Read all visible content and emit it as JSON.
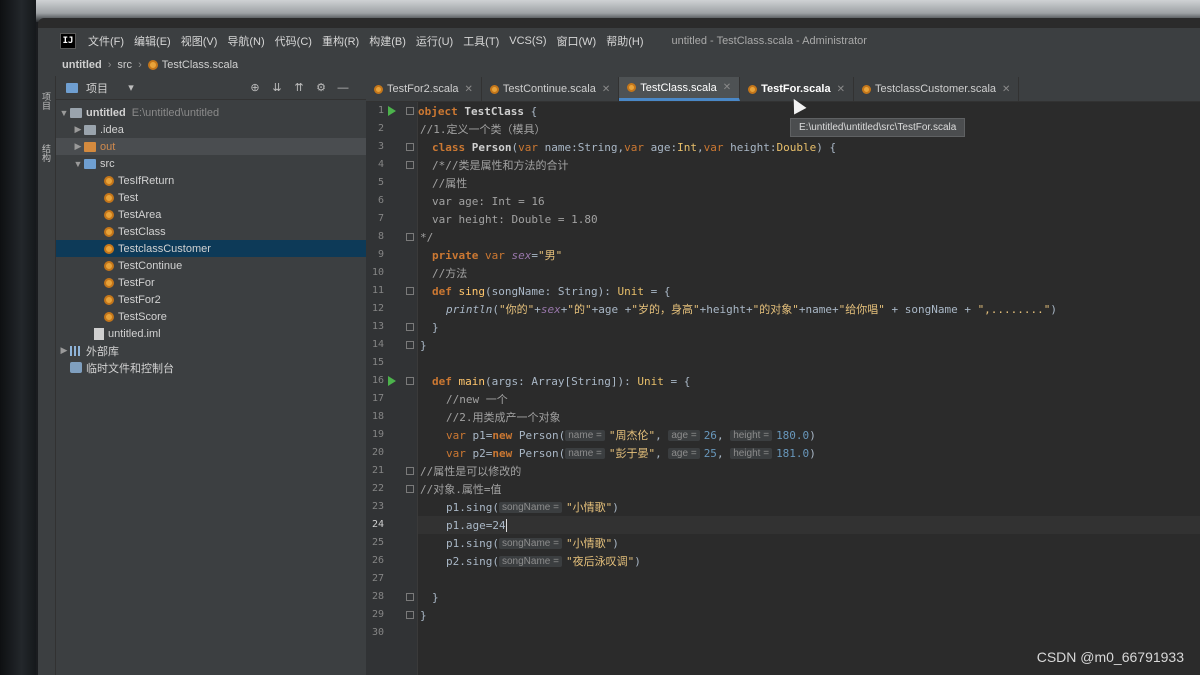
{
  "app": {
    "logo_text": "IJ",
    "window_title": "untitled - TestClass.scala - Administrator"
  },
  "menu": [
    {
      "label": "文件(F)"
    },
    {
      "label": "编辑(E)"
    },
    {
      "label": "视图(V)"
    },
    {
      "label": "导航(N)"
    },
    {
      "label": "代码(C)"
    },
    {
      "label": "重构(R)"
    },
    {
      "label": "构建(B)"
    },
    {
      "label": "运行(U)"
    },
    {
      "label": "工具(T)"
    },
    {
      "label": "VCS(S)"
    },
    {
      "label": "窗口(W)"
    },
    {
      "label": "帮助(H)"
    }
  ],
  "breadcrumb": {
    "project": "untitled",
    "folder": "src",
    "file": "TestClass.scala"
  },
  "tool_strip": {
    "project_label": "项目",
    "structure_label": "结构"
  },
  "project_panel": {
    "title": "项目",
    "tree": {
      "root": "untitled",
      "root_path": "E:\\untitled\\untitled",
      "idea": ".idea",
      "out": "out",
      "src": "src",
      "files": [
        "TesIfReturn",
        "Test",
        "TestArea",
        "TestClass",
        "TestclassCustomer",
        "TestContinue",
        "TestFor",
        "TestFor2",
        "TestScore"
      ],
      "iml": "untitled.iml",
      "external_libs": "外部库",
      "scratches": "临时文件和控制台"
    }
  },
  "tabs": [
    {
      "label": "TestFor2.scala"
    },
    {
      "label": "TestContinue.scala"
    },
    {
      "label": "TestClass.scala"
    },
    {
      "label": "TestFor.scala"
    },
    {
      "label": "TestclassCustomer.scala"
    }
  ],
  "tooltip": "E:\\untitled\\untitled\\src\\TestFor.scala",
  "editor": {
    "line_numbers": [
      "1",
      "2",
      "3",
      "4",
      "5",
      "6",
      "7",
      "8",
      "9",
      "10",
      "11",
      "12",
      "13",
      "14",
      "15",
      "16",
      "17",
      "18",
      "19",
      "20",
      "21",
      "22",
      "23",
      "24",
      "25",
      "26",
      "27",
      "28",
      "29",
      "30"
    ],
    "code": {
      "l1_kw": "object",
      "l1_name": "TestClass",
      "l1_rest": " {",
      "l2": "//1.定义一个类（模具）",
      "l3_kw": "class",
      "l3_name": "Person",
      "l3_p1": "(",
      "l3_var1": "var",
      "l3_p2": " name:String,",
      "l3_var2": "var",
      "l3_p3": " age:",
      "l3_t1": "Int",
      "l3_p4": ",",
      "l3_var3": "var",
      "l3_p5": " height:",
      "l3_t2": "Double",
      "l3_p6": ") {",
      "l4": "/*//类是属性和方法的合计",
      "l5": "//属性",
      "l6": "var age: Int = 16",
      "l7": "var height: Double = 1.80",
      "l8": "*/",
      "l9_kw": "private",
      "l9_var": " var ",
      "l9_field": "sex",
      "l9_eq": "=",
      "l9_str": "\"男\"",
      "l10": "//方法",
      "l11_kw": "def",
      "l11_name": "sing",
      "l11_p1": "(songName: String): ",
      "l11_t": "Unit",
      "l11_p2": " = {",
      "l12_fn": "println",
      "l12_p1": "(",
      "l12_s1": "\"你的\"",
      "l12_plus1": "+",
      "l12_field": "sex",
      "l12_plus2": "+",
      "l12_s2": "\"的\"",
      "l12_p2": "+age +",
      "l12_s3": "\"岁的，身高\"",
      "l12_p3": "+height+",
      "l12_s4": "\"的对象\"",
      "l12_p4": "+name+",
      "l12_s5": "\"给你唱\"",
      "l12_p5": " + songName + ",
      "l12_s6": "\",........\"",
      "l12_p6": ")",
      "l13": "}",
      "l14": "}",
      "l16_kw": "def",
      "l16_name": "main",
      "l16_p1": "(args: Array[String]): ",
      "l16_t": "Unit",
      "l16_p2": " = {",
      "l17": "//new 一个",
      "l18": "//2.用类成产一个对象",
      "l19_var": "var",
      "l19_p1": " p1=",
      "l19_new": "new",
      "l19_p2": " Person(",
      "l19_h1": "name =",
      "l19_s1": "\"周杰伦\"",
      "l19_c1": ",",
      "l19_h2": "age =",
      "l19_n1": "26",
      "l19_c2": ",",
      "l19_h3": "height =",
      "l19_n2": "180.0",
      "l19_p3": ")",
      "l20_var": "var",
      "l20_p1": " p2=",
      "l20_new": "new",
      "l20_p2": " Person(",
      "l20_h1": "name =",
      "l20_s1": "\"彭于晏\"",
      "l20_c1": ",",
      "l20_h2": "age =",
      "l20_n1": "25",
      "l20_c2": ",",
      "l20_h3": "height =",
      "l20_n2": "181.0",
      "l20_p3": ")",
      "l21": "//属性是可以修改的",
      "l22": "//对象.属性=值",
      "l23_p1": "p1.sing(",
      "l23_h": "songName =",
      "l23_s": "\"小情歌\"",
      "l23_p2": ")",
      "l24": "p1.age=24",
      "l25_p1": "p1.sing(",
      "l25_h": "songName =",
      "l25_s": "\"小情歌\"",
      "l25_p2": ")",
      "l26_p1": "p2.sing(",
      "l26_h": "songName =",
      "l26_s": "\"夜后泳叹调\"",
      "l26_p2": ")",
      "l28": "}",
      "l29": "}"
    }
  },
  "watermark": "CSDN @m0_66791933",
  "colors": {
    "keyword": "#cc7832",
    "string": "#6a8759",
    "number": "#6897bb",
    "comment": "#a2a2a2",
    "field": "#9876aa",
    "selection": "#0d3a58",
    "run_marker": "#4cb34c"
  }
}
